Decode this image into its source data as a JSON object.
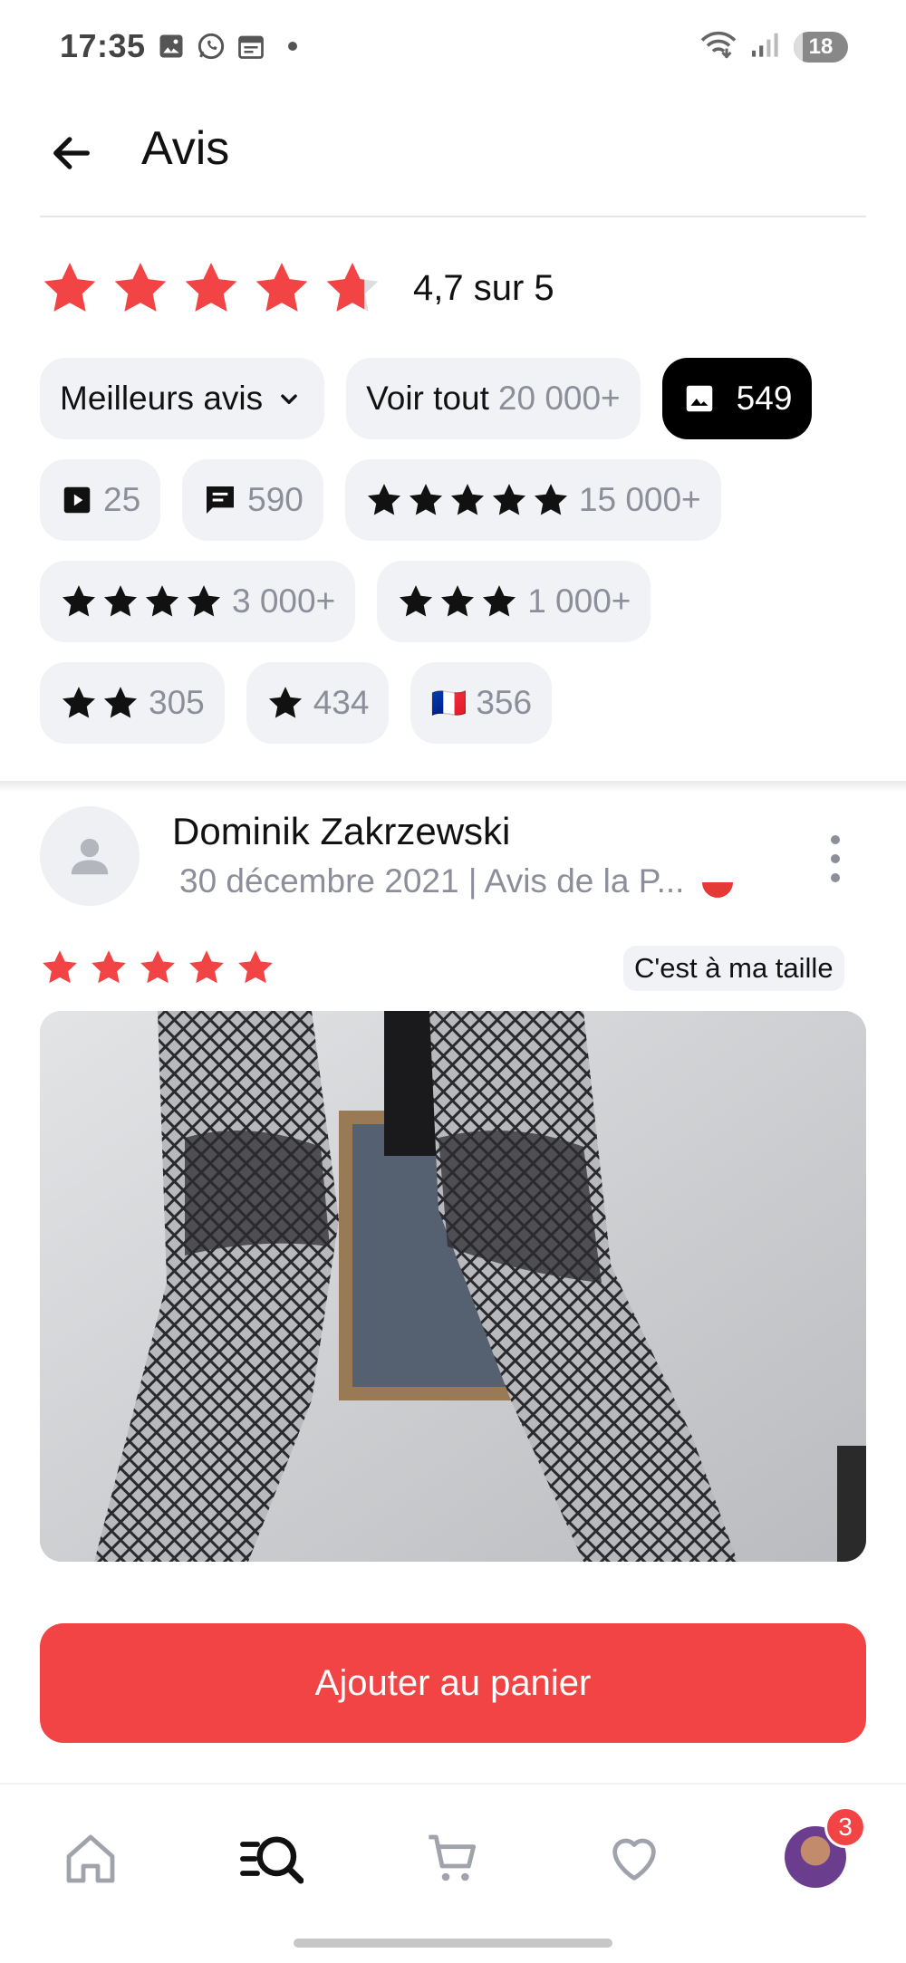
{
  "status_bar": {
    "time": "17:35",
    "battery": "18",
    "left_icons": [
      "image-icon",
      "whatsapp-icon",
      "calendar-icon"
    ],
    "right_icons": [
      "wifi-icon",
      "signal-icon",
      "battery-icon"
    ]
  },
  "header": {
    "title": "Avis"
  },
  "rating": {
    "value": 4.7,
    "max": 5,
    "text": "4,7 sur 5",
    "star_color": "#f24444"
  },
  "filters": {
    "sort_label": "Meilleurs avis",
    "all_label": "Voir tout",
    "all_count": "20 000+",
    "photos_count": "549",
    "videos_count": "25",
    "comments_count": "590",
    "five_star_count": "15 000+",
    "four_star_count": "3 000+",
    "three_star_count": "1 000+",
    "two_star_count": "305",
    "one_star_count": "434",
    "country_flag": "🇫🇷",
    "country_count": "356"
  },
  "review": {
    "author": "Dominik Zakrzewski",
    "meta": "30 décembre 2021 | Avis de la P...",
    "stars": 5,
    "fit_label": "C'est à ma taille"
  },
  "actions": {
    "add_to_cart": "Ajouter au panier"
  },
  "bottom_nav": {
    "items": [
      "home-icon",
      "categories-search-icon",
      "cart-icon",
      "heart-icon",
      "profile-avatar"
    ],
    "profile_badge": "3"
  },
  "colors": {
    "accent": "#f24444",
    "chip_bg": "#f1f2f5",
    "muted_text": "#8c8f99"
  }
}
